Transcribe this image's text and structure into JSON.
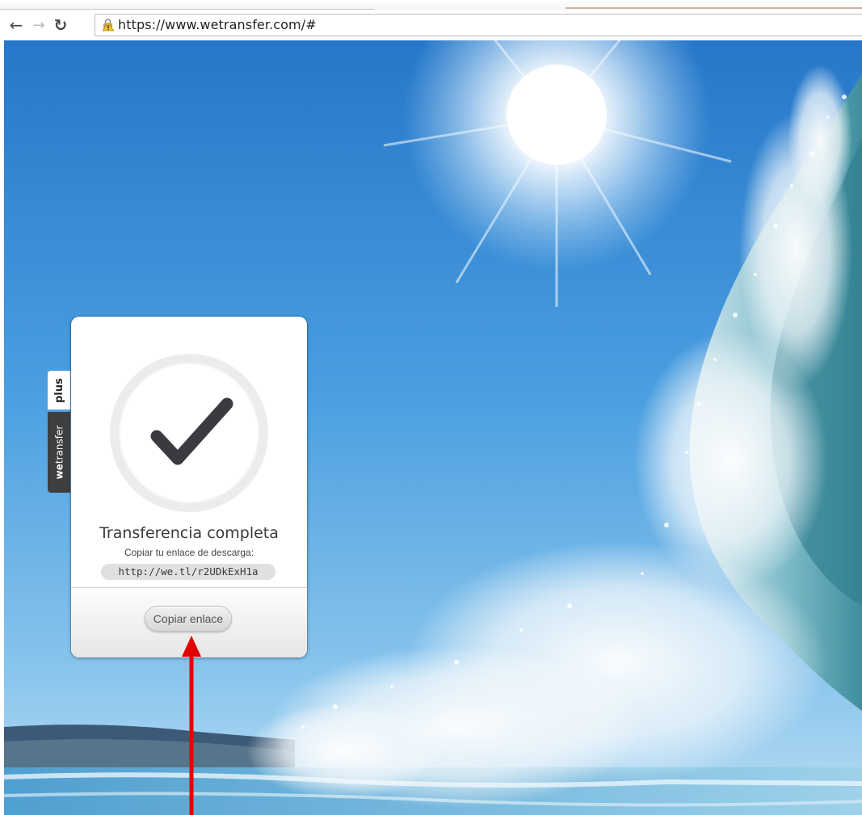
{
  "browser": {
    "back_icon": "arrow-left-icon",
    "forward_icon": "arrow-right-icon",
    "reload_icon": "reload-icon",
    "security_icon": "warning-lock-icon",
    "url": "https://www.wetransfer.com/#"
  },
  "side_tab": {
    "plus_label": "plus",
    "brand_bold": "we",
    "brand_rest": "transfer"
  },
  "card": {
    "status_icon": "checkmark-icon",
    "title": "Transferencia completa",
    "subtitle": "Copiar tu enlace de descarga:",
    "link": "http://we.tl/r2UDkExH1a",
    "copy_button": "Copiar enlace"
  },
  "annotation": {
    "arrow_color": "#e00000"
  },
  "colors": {
    "sky_top": "#1f74c9",
    "sky_bottom": "#8cc9ef",
    "checkmark": "#3b3b3f",
    "tab_dark": "#3f3f42"
  }
}
